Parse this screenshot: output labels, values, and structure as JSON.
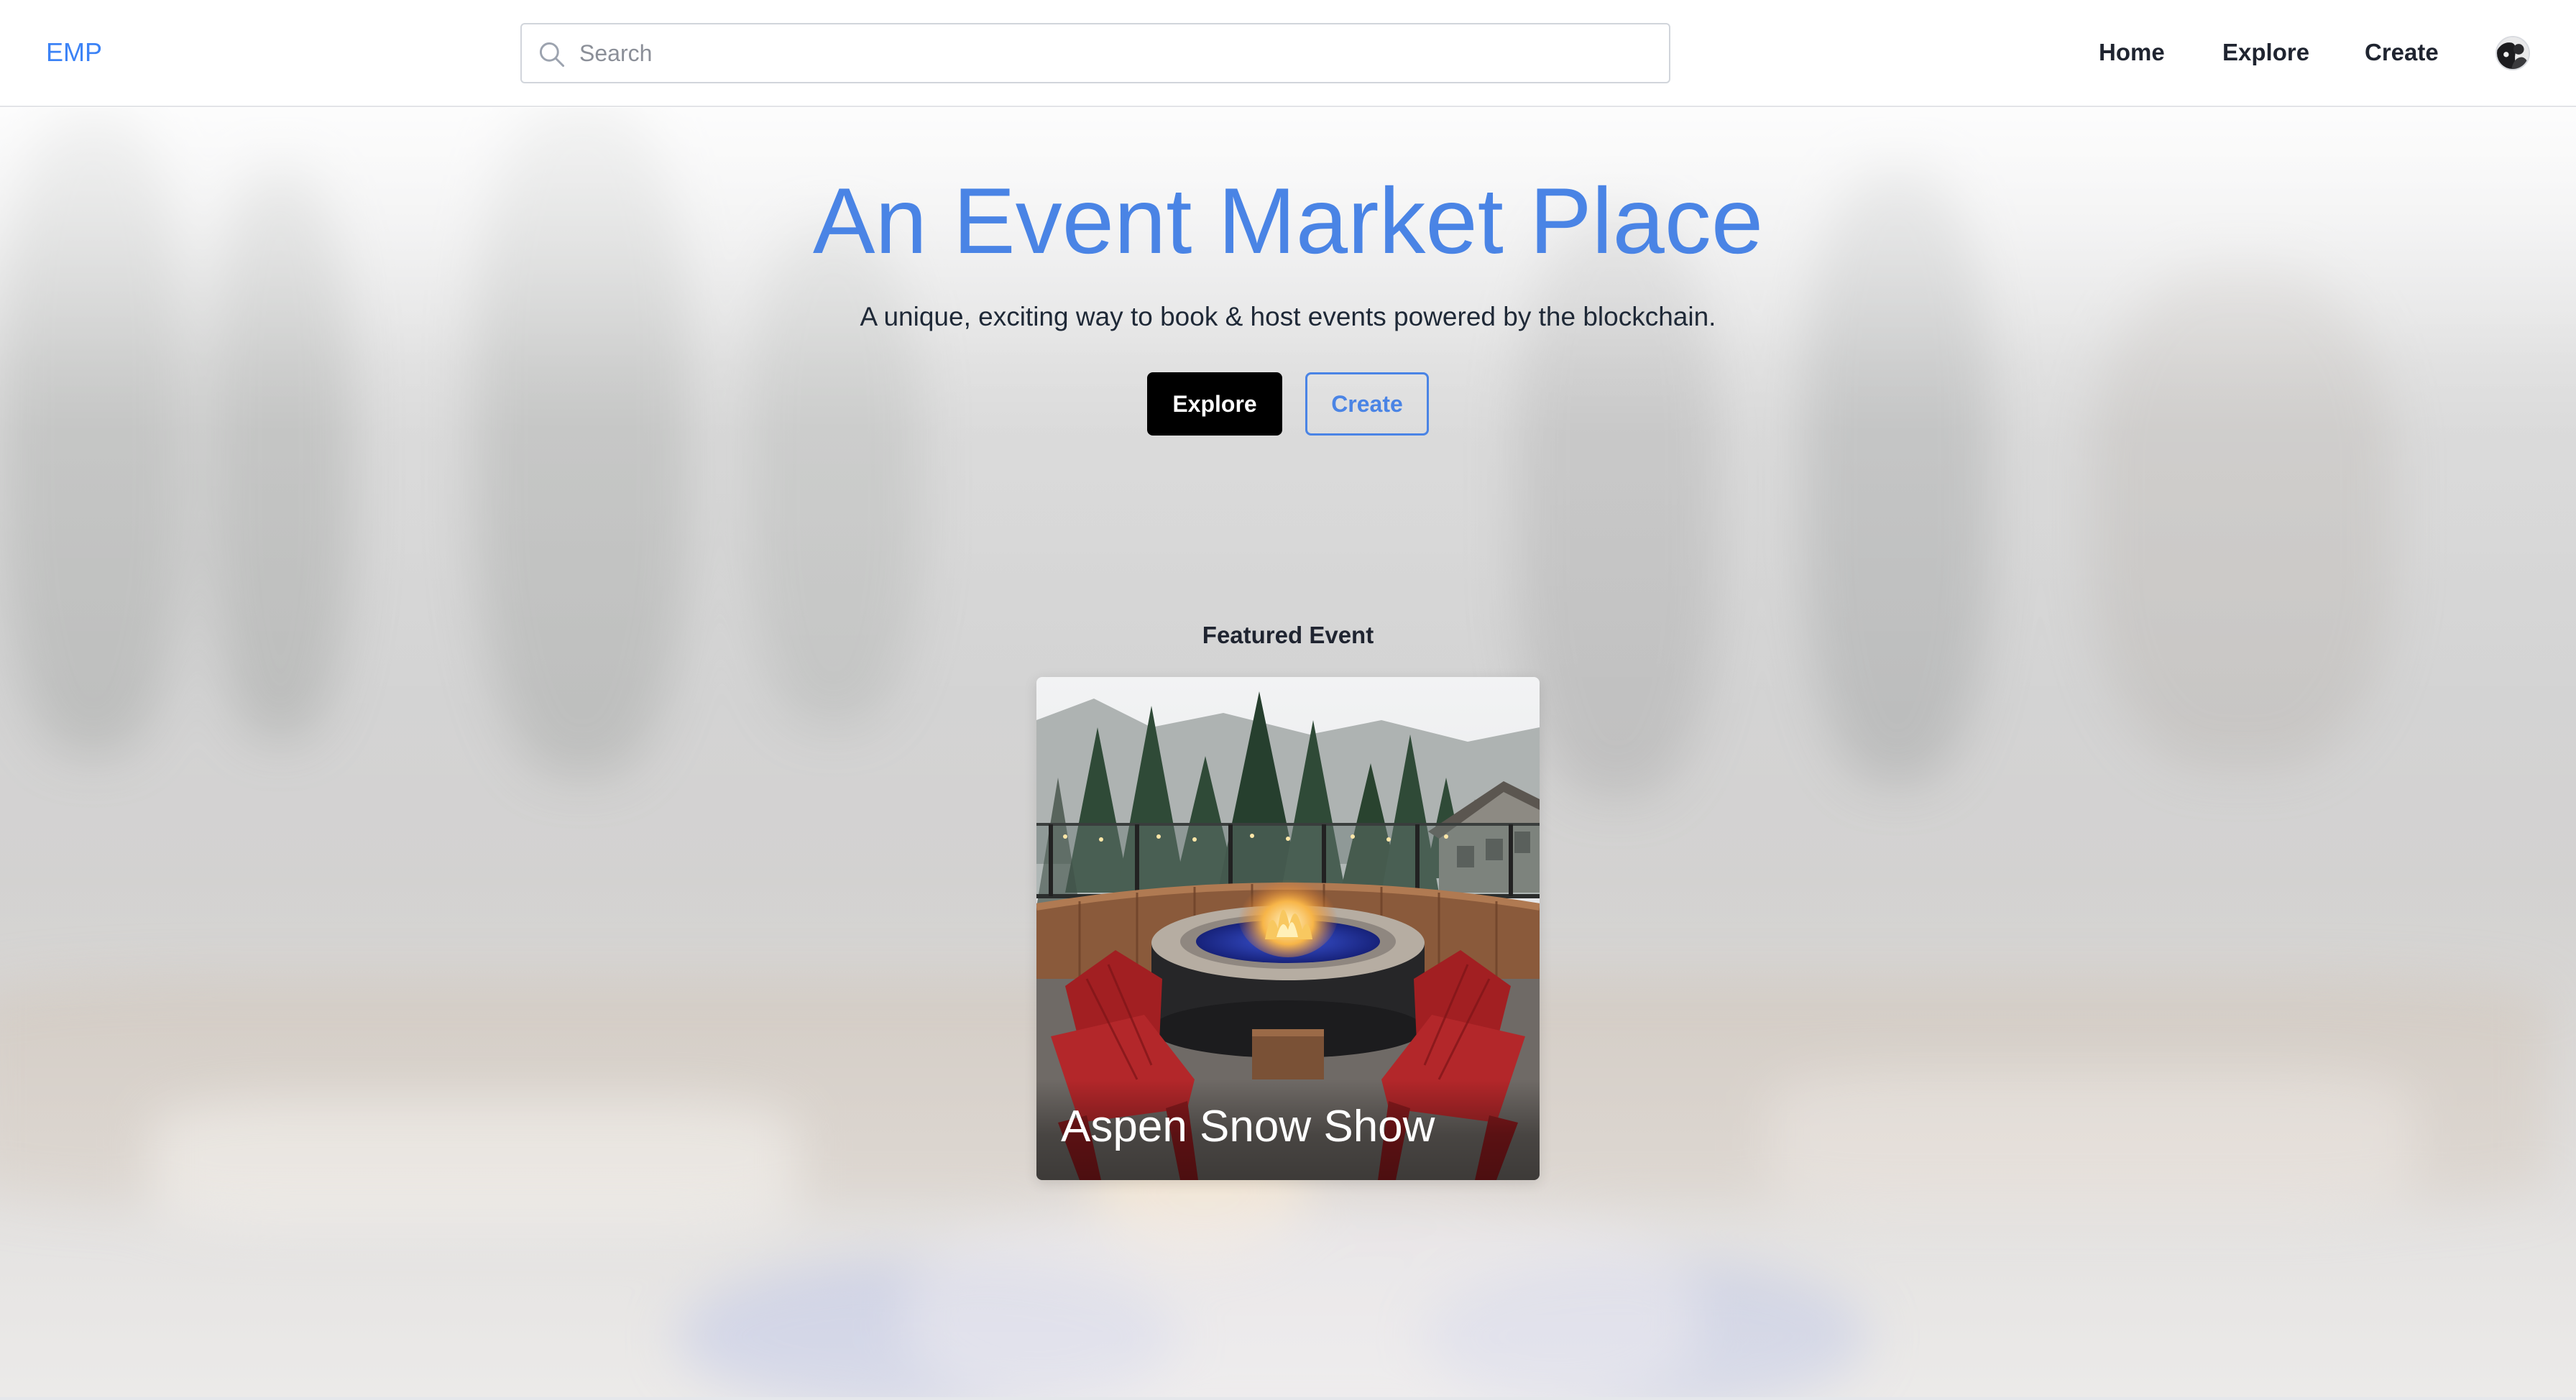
{
  "header": {
    "brand": "EMP",
    "search": {
      "placeholder": "Search",
      "value": ""
    },
    "nav": [
      {
        "label": "Home"
      },
      {
        "label": "Explore"
      },
      {
        "label": "Create"
      }
    ],
    "avatar_icon": "user-avatar"
  },
  "hero": {
    "title": "An Event Market Place",
    "subtitle": "A unique, exciting way to book & host events powered by the blockchain.",
    "explore_label": "Explore",
    "create_label": "Create"
  },
  "featured": {
    "label": "Featured Event",
    "event_title": "Aspen Snow Show"
  },
  "colors": {
    "accent": "#4a84e5",
    "primary_button": "#000000",
    "text": "#1f2430"
  }
}
